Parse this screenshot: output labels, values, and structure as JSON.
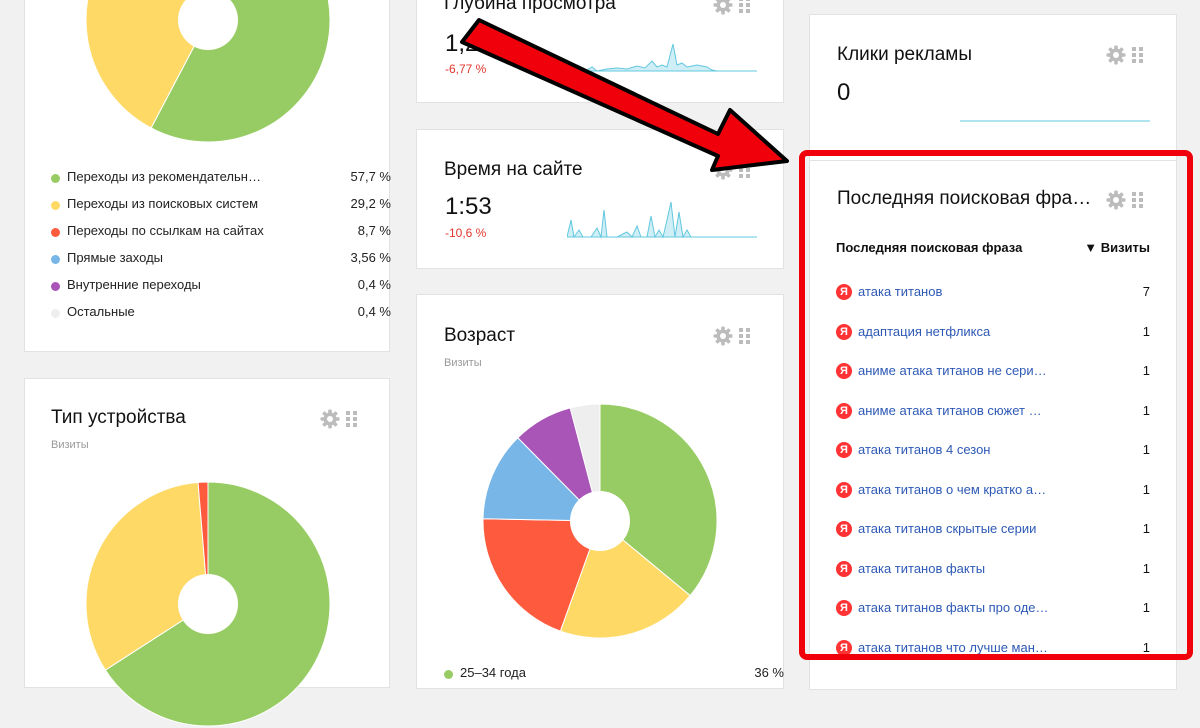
{
  "colors": {
    "green": "#97cc64",
    "yellow": "#fed966",
    "red": "#fd5a3e",
    "blue": "#77b6e7",
    "purple": "#a955b8",
    "gray": "#eeeeee",
    "spark": "#62c8df",
    "delta_red": "#e0362e",
    "link": "#2d59b5",
    "highlight": "#f0000a"
  },
  "sources": {
    "legend": [
      {
        "name": "Переходы из рекомендательн…",
        "value": "57,7 %",
        "share": 57.7,
        "color": "#97cc64"
      },
      {
        "name": "Переходы из поисковых систем",
        "value": "29,2 %",
        "share": 29.2,
        "color": "#fed966"
      },
      {
        "name": "Переходы по ссылкам на сайтах",
        "value": "8,7 %",
        "share": 8.7,
        "color": "#fd5a3e"
      },
      {
        "name": "Прямые заходы",
        "value": "3,56 %",
        "share": 3.56,
        "color": "#77b6e7"
      },
      {
        "name": "Внутренние переходы",
        "value": "0,4 %",
        "share": 0.4,
        "color": "#a955b8"
      },
      {
        "name": "Остальные",
        "value": "0,4 %",
        "share": 0.4,
        "color": "#eeeeee"
      }
    ]
  },
  "device": {
    "title": "Тип устройства",
    "subtitle": "Визиты",
    "slices": [
      {
        "share": 65.9,
        "color": "#97cc64"
      },
      {
        "share": 32.8,
        "color": "#fed966"
      },
      {
        "share": 1.3,
        "color": "#fd5a3e"
      }
    ]
  },
  "depth": {
    "title": "Глубина просмотра",
    "value": "1,2",
    "delta": "-6,77 %"
  },
  "time": {
    "title": "Время на сайте",
    "value": "1:53",
    "delta": "-10,6 %"
  },
  "age": {
    "title": "Возраст",
    "subtitle": "Визиты",
    "slices": [
      {
        "share": 36,
        "color": "#97cc64"
      },
      {
        "share": 19.5,
        "color": "#fed966"
      },
      {
        "share": 19.8,
        "color": "#fd5a3e"
      },
      {
        "share": 12.3,
        "color": "#77b6e7"
      },
      {
        "share": 8.3,
        "color": "#a955b8"
      },
      {
        "share": 4.1,
        "color": "#eeeeee"
      }
    ],
    "legend_first": {
      "name": "25–34 года",
      "value": "36 %"
    }
  },
  "ads": {
    "title": "Клики рекламы",
    "value": "0"
  },
  "search": {
    "title": "Последняя поисковая фра…",
    "col_phrase": "Последняя поисковая фраза",
    "col_visits": "▼ Визиты",
    "rows": [
      {
        "phrase": "атака титанов",
        "visits": "7"
      },
      {
        "phrase": "адаптация нетфликса",
        "visits": "1"
      },
      {
        "phrase": "аниме атака титанов не сери…",
        "visits": "1"
      },
      {
        "phrase": "аниме атака титанов сюжет …",
        "visits": "1"
      },
      {
        "phrase": "атака титанов 4 сезон",
        "visits": "1"
      },
      {
        "phrase": "атака титанов о чем кратко а…",
        "visits": "1"
      },
      {
        "phrase": "атака титанов скрытые серии",
        "visits": "1"
      },
      {
        "phrase": "атака титанов факты",
        "visits": "1"
      },
      {
        "phrase": "атака титанов факты про оде…",
        "visits": "1"
      },
      {
        "phrase": "атака титанов что лучше ман…",
        "visits": "1"
      }
    ]
  }
}
